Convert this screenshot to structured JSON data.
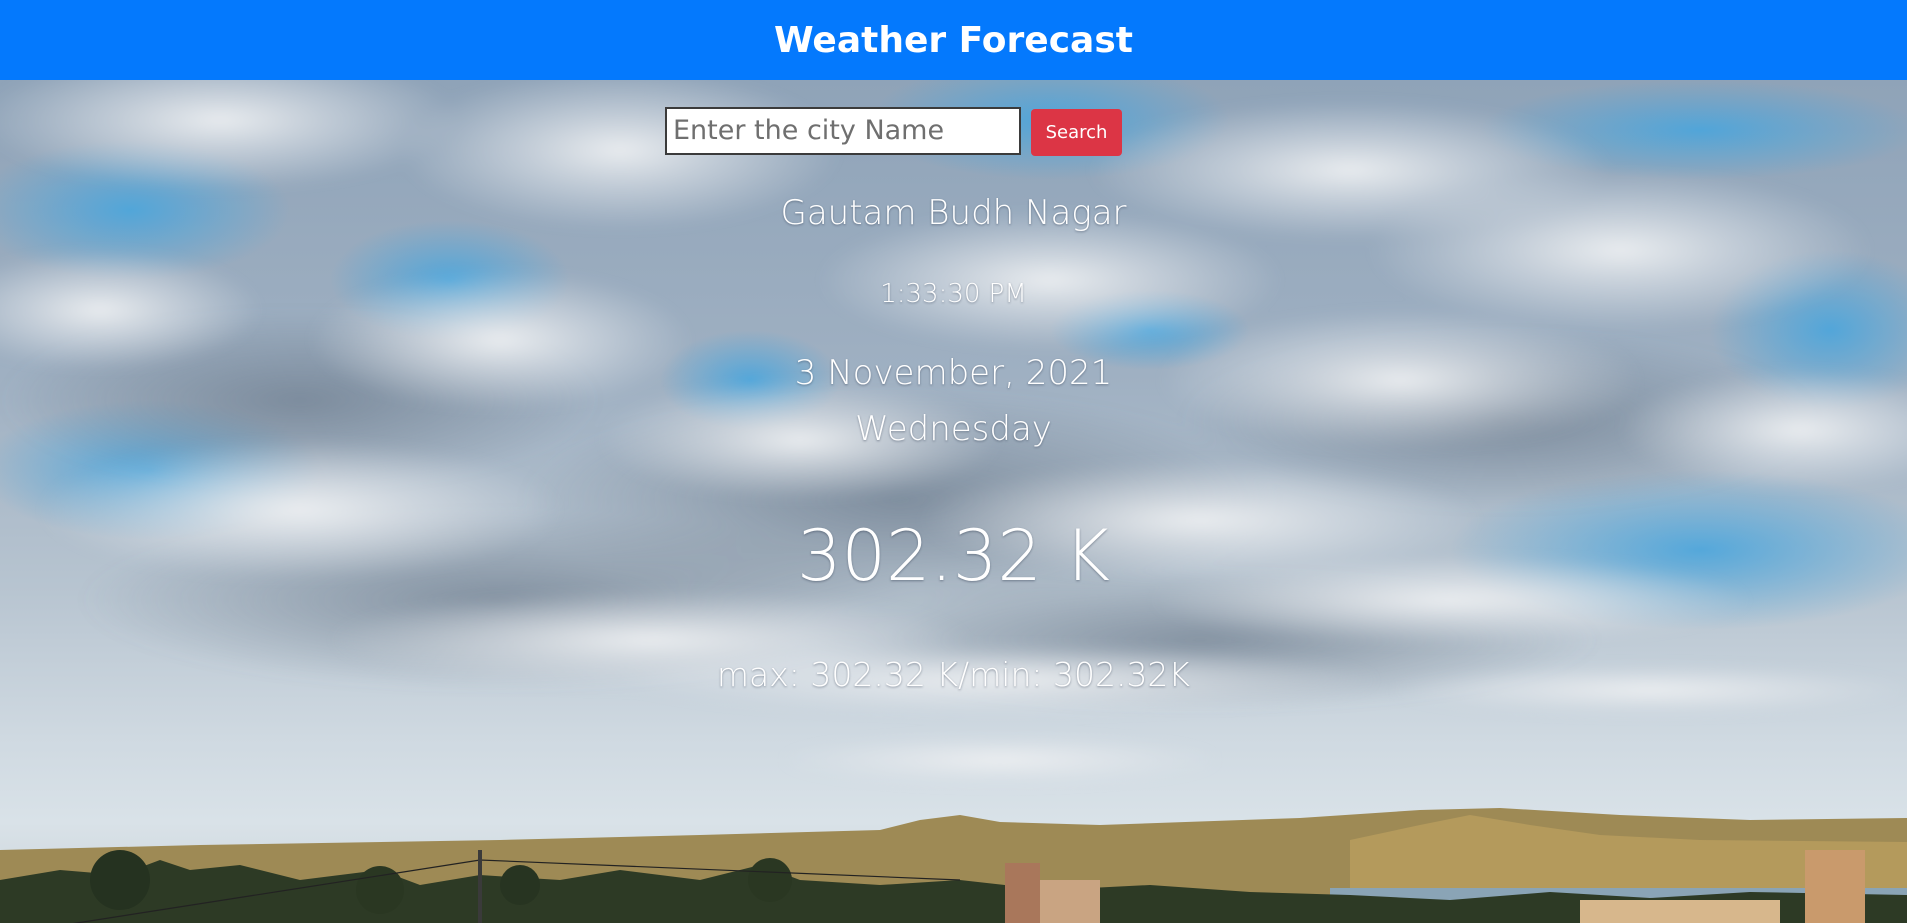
{
  "header": {
    "title": "Weather Forecast"
  },
  "search": {
    "placeholder": "Enter the city Name",
    "value": "",
    "button_label": "Search"
  },
  "weather": {
    "city": "Gautam Budh Nagar",
    "time": "1:33:30 PM",
    "date": "3 November, 2021",
    "day": "Wednesday",
    "temperature": "302.32 K",
    "min_max": "max: 302.32 K/min: 302.32K"
  },
  "colors": {
    "header_bg": "#0479fd",
    "search_button": "#dc3545",
    "text": "#ffffff"
  }
}
